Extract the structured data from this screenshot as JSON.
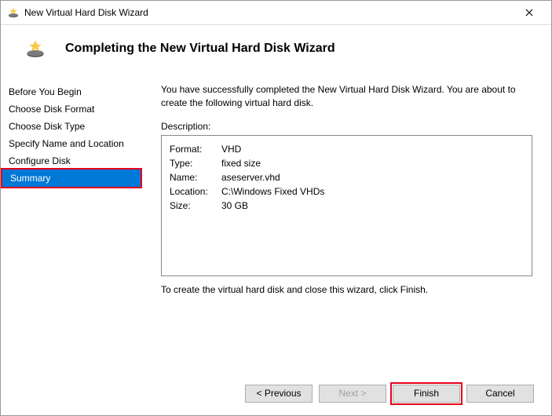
{
  "window": {
    "title": "New Virtual Hard Disk Wizard"
  },
  "header": {
    "title": "Completing the New Virtual Hard Disk Wizard"
  },
  "sidebar": {
    "items": [
      {
        "label": "Before You Begin"
      },
      {
        "label": "Choose Disk Format"
      },
      {
        "label": "Choose Disk Type"
      },
      {
        "label": "Specify Name and Location"
      },
      {
        "label": "Configure Disk"
      },
      {
        "label": "Summary"
      }
    ]
  },
  "main": {
    "intro": "You have successfully completed the New Virtual Hard Disk Wizard. You are about to create the following virtual hard disk.",
    "description_label": "Description:",
    "details": {
      "format_key": "Format:",
      "format_val": "VHD",
      "type_key": "Type:",
      "type_val": "fixed size",
      "name_key": "Name:",
      "name_val": "aseserver.vhd",
      "location_key": "Location:",
      "location_val": "C:\\Windows Fixed VHDs",
      "size_key": "Size:",
      "size_val": "30 GB"
    },
    "closing": "To create the virtual hard disk and close this wizard, click Finish."
  },
  "buttons": {
    "previous": "< Previous",
    "next": "Next >",
    "finish": "Finish",
    "cancel": "Cancel"
  }
}
